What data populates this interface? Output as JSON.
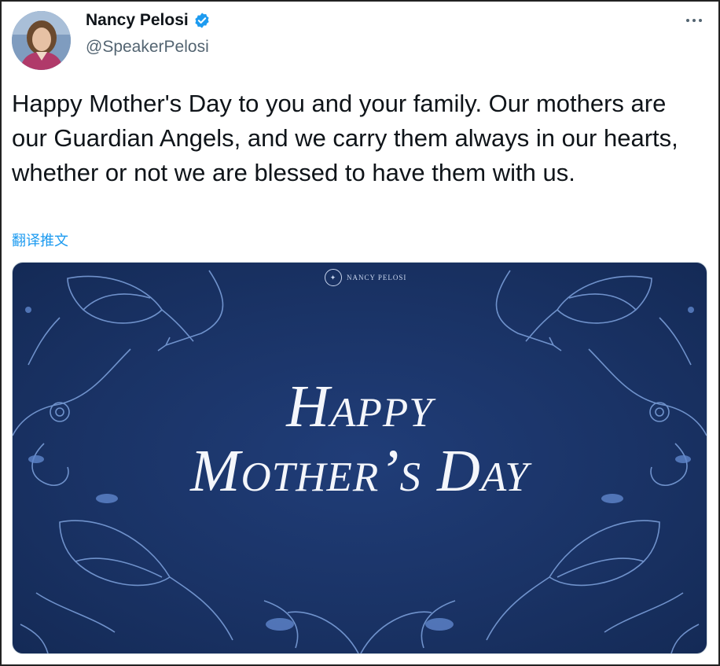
{
  "tweet": {
    "author_name": "Nancy Pelosi",
    "handle": "@SpeakerPelosi",
    "verified_icon": "verified-badge-icon",
    "more_icon": "more-options-icon",
    "text": "Happy Mother's Day to you and your family. Our mothers are our Guardian Angels, and we carry them always in our hearts, whether or not we are blessed to have them with us.",
    "translate_label": "翻译推文"
  },
  "media": {
    "logo_text": "NANCY PELOSI",
    "headline_line1": "Happy",
    "headline_line2": "Mother’s Day",
    "background_color": "#1a3366",
    "ornament_color": "#7fa3de"
  },
  "colors": {
    "text": "#0f1419",
    "secondary": "#536471",
    "link": "#1d9bf0",
    "verified": "#1d9bf0"
  }
}
